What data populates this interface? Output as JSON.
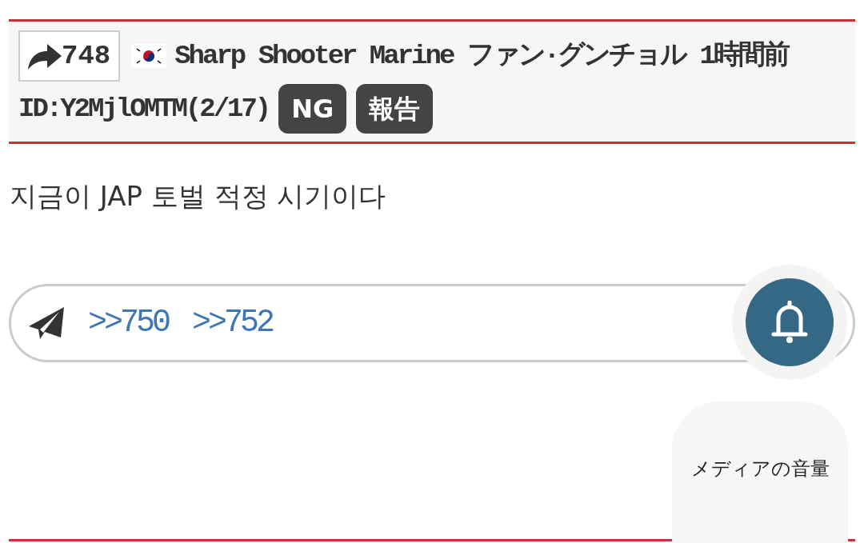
{
  "post": {
    "number": "748",
    "name": "Sharp Shooter Marine ファン·グンチョル",
    "time": "1時間前",
    "id": "ID:Y2MjlOMTM(2/17)",
    "buttons": [
      "NG",
      "報告"
    ],
    "body": "지금이 JAP 토벌 적정 시기이다"
  },
  "replies": [
    ">>750",
    ">>752"
  ],
  "volume_popup": {
    "label": "メディアの音量"
  }
}
